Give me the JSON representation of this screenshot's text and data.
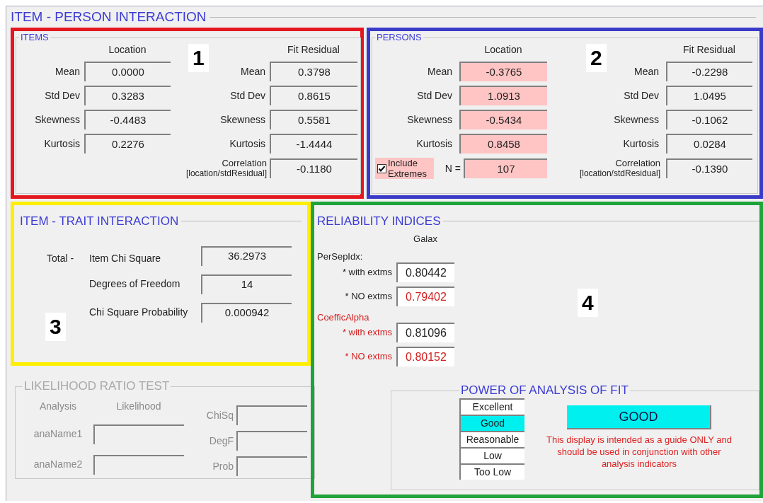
{
  "window": {
    "title": "ITEM - PERSON INTERACTION"
  },
  "items": {
    "title": "ITEMS",
    "marker": "1",
    "columns": [
      "Location",
      "Fit Residual"
    ],
    "location_stats": [
      {
        "label": "Mean",
        "value": "0.0000",
        "highlighted": false
      },
      {
        "label": "Std Dev",
        "value": "0.3283",
        "highlighted": false
      },
      {
        "label": "Skewness",
        "value": "-0.4483",
        "highlighted": false
      },
      {
        "label": "Kurtosis",
        "value": "0.2276",
        "highlighted": false
      }
    ],
    "fit_stats": [
      {
        "label": "Mean",
        "value": "0.3798"
      },
      {
        "label": "Std Dev",
        "value": "0.8615"
      },
      {
        "label": "Skewness",
        "value": "0.5581"
      },
      {
        "label": "Kurtosis",
        "value": "-1.4444"
      }
    ],
    "correlation": {
      "label": "Correlation",
      "sublabel": "[location/stdResidual]",
      "value": "-0.1180"
    }
  },
  "persons": {
    "title": "PERSONS",
    "marker": "2",
    "columns": [
      "Location",
      "Fit Residual"
    ],
    "location_stats": [
      {
        "label": "Mean",
        "value": "-0.3765",
        "highlighted": true
      },
      {
        "label": "Std Dev",
        "value": "1.0913",
        "highlighted": true
      },
      {
        "label": "Skewness",
        "value": "-0.5434",
        "highlighted": true
      },
      {
        "label": "Kurtosis",
        "value": "0.8458",
        "highlighted": true
      }
    ],
    "fit_stats": [
      {
        "label": "Mean",
        "value": "-0.2298"
      },
      {
        "label": "Std Dev",
        "value": "1.0495"
      },
      {
        "label": "Skewness",
        "value": "-0.1062"
      },
      {
        "label": "Kurtosis",
        "value": "0.0284"
      }
    ],
    "include_extremes": {
      "label": "Include Extremes",
      "checked": true
    },
    "n": {
      "label": "N =",
      "value": "107",
      "highlighted": true
    },
    "correlation": {
      "label": "Correlation",
      "sublabel": "[location/stdResidual]",
      "value": "-0.1390"
    }
  },
  "item_trait": {
    "title": "ITEM - TRAIT INTERACTION",
    "marker": "3",
    "prefix": "Total -",
    "rows": [
      {
        "label": "Item Chi Square",
        "value": "36.2973"
      },
      {
        "label": "Degrees of Freedom",
        "value": "14"
      },
      {
        "label": "Chi Square Probability",
        "value": "0.000942"
      }
    ]
  },
  "likelihood": {
    "title": "LIKELIHOOD  RATIO  TEST",
    "disabled": true,
    "columns": [
      "Analysis",
      "Likelihood"
    ],
    "analyses": [
      "anaName1",
      "anaName2"
    ],
    "stats": [
      "ChiSq",
      "DegF",
      "Prob"
    ]
  },
  "reliability": {
    "title": "RELIABILITY  INDICES",
    "marker": "4",
    "column": "Galax",
    "groups": [
      {
        "title": "PerSepIdx:",
        "alert": false,
        "rows": [
          {
            "label": "* with extms",
            "value": "0.80442",
            "alert": false
          },
          {
            "label": "* NO extms",
            "value": "0.79402",
            "alert": true
          }
        ]
      },
      {
        "title": "CoefficAlpha",
        "alert": true,
        "rows": [
          {
            "label": "* with extms",
            "value": "0.81096",
            "alert": false
          },
          {
            "label": "* NO extms",
            "value": "0.80152",
            "alert": true
          }
        ]
      }
    ]
  },
  "power": {
    "title": "POWER  OF  ANALYSIS  OF  FIT",
    "levels": [
      {
        "label": "Excellent",
        "selected": false
      },
      {
        "label": "Good",
        "selected": true
      },
      {
        "label": "Reasonable",
        "selected": false
      },
      {
        "label": "Low",
        "selected": false
      },
      {
        "label": "Too Low",
        "selected": false
      }
    ],
    "result": "GOOD",
    "note": "This display is intended as a guide ONLY and should be used in conjunction with other analysis indicators"
  }
}
